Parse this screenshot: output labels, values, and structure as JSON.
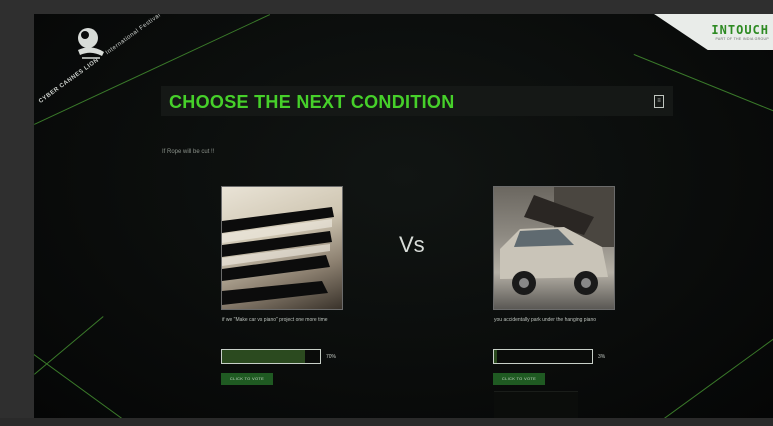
{
  "award": {
    "line1": "CYBER CANNES LION",
    "line2": "International Festival"
  },
  "brand": {
    "name": "INTOUCH",
    "tagline": "PART OF THE INDIA GROUP"
  },
  "page_title": "CHOOSE THE NEXT CONDITION",
  "subtitle": "If Rope will be cut !!",
  "left_option": {
    "caption": "if we \"Make car vs piano\" project one more time",
    "percent_label": "70%",
    "percent_value": 0.85,
    "vote_label": "CLICK TO VOTE"
  },
  "vs_label": "Vs",
  "right_option": {
    "caption": "you accidentally park under the hanging piano",
    "percent_label": "3%",
    "percent_value": 0.03,
    "vote_label": "CLICK TO VOTE"
  },
  "colors": {
    "accent": "#46d02a",
    "vote_button": "#1f5a22",
    "bar_fill": "#2b4a1f"
  }
}
